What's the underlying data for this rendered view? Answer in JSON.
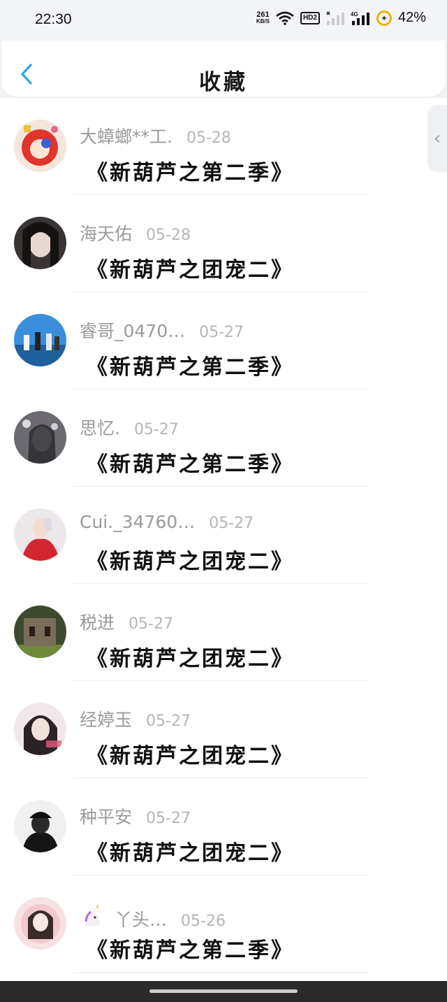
{
  "status_bar": {
    "time": "22:30",
    "net_speed_value": "261",
    "net_speed_unit": "KB/S",
    "hd_label": "HD2",
    "battery": "42%",
    "icons": [
      "wifi-icon",
      "hd-icon",
      "signal-icon",
      "signal-4g-icon",
      "battery-icon"
    ]
  },
  "header": {
    "title": "收藏",
    "back_icon": "chevron-left-icon",
    "accent_color": "#2aa4f4"
  },
  "side_handle_icon": "chevron-left-icon",
  "items": [
    {
      "name": "大蟑螂**工.",
      "date": "05-28",
      "title": "《新葫芦之第二季》",
      "avatar": "avatar-red-hair-character"
    },
    {
      "name": "海天佑",
      "date": "05-28",
      "title": "《新葫芦之团宠二》",
      "avatar": "avatar-girl-dark"
    },
    {
      "name": "睿哥_0470…",
      "date": "05-27",
      "title": "《新葫芦之第二季》",
      "avatar": "avatar-blue-sky-group"
    },
    {
      "name": "思忆.",
      "date": "05-27",
      "title": "《新葫芦之第二季》",
      "avatar": "avatar-anime-girl"
    },
    {
      "name": "Cui._34760…",
      "date": "05-27",
      "title": "《新葫芦之团宠二》",
      "avatar": "avatar-red-dress-selfie"
    },
    {
      "name": "税进",
      "date": "05-27",
      "title": "《新葫芦之团宠二》",
      "avatar": "avatar-ruins"
    },
    {
      "name": "经婷玉",
      "date": "05-27",
      "title": "《新葫芦之团宠二》",
      "avatar": "avatar-girl-pink"
    },
    {
      "name": "种平安",
      "date": "05-27",
      "title": "《新葫芦之团宠二》",
      "avatar": "avatar-black-cap"
    },
    {
      "name": "丫头…",
      "date": "05-26",
      "title": "《新葫芦之第二季》",
      "avatar": "avatar-hanfu-girl",
      "name_prefix_icon": "unicorn-icon"
    }
  ]
}
